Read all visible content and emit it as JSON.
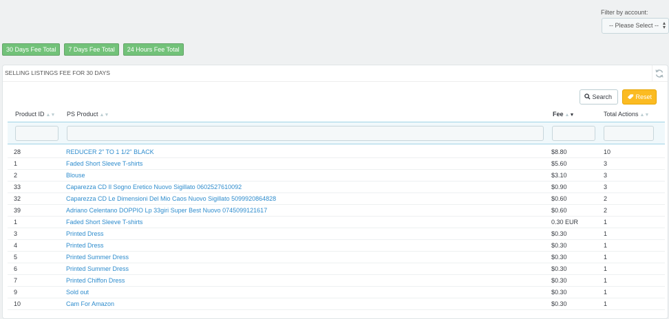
{
  "filter": {
    "label": "Filter by account:",
    "selected": "-- Please Select --"
  },
  "fee_buttons": [
    "30 Days Fee Total",
    "7 Days Fee Total",
    "24 Hours Fee Total"
  ],
  "panel": {
    "title": "SELLING LISTINGS FEE FOR 30 DAYS"
  },
  "actions": {
    "search": "Search",
    "reset": "Reset"
  },
  "columns": {
    "id": "Product ID",
    "product": "PS Product",
    "fee": "Fee",
    "actions": "Total Actions"
  },
  "colors": {
    "accent_green": "#72c279",
    "link_blue": "#2e8ccd",
    "reset_orange": "#fbbb22"
  },
  "rows": [
    {
      "id": "28",
      "product": "REDUCER 2\" TO 1 1/2\" BLACK",
      "fee": "$8.80",
      "actions": "10"
    },
    {
      "id": "1",
      "product": "Faded Short Sleeve T-shirts",
      "fee": "$5.60",
      "actions": "3"
    },
    {
      "id": "2",
      "product": "Blouse",
      "fee": "$3.10",
      "actions": "3"
    },
    {
      "id": "33",
      "product": "Caparezza CD Il Sogno Eretico Nuovo Sigillato 0602527610092",
      "fee": "$0.90",
      "actions": "3"
    },
    {
      "id": "32",
      "product": "Caparezza CD Le Dimensioni Del Mio Caos Nuovo Sigillato 5099920864828",
      "fee": "$0.60",
      "actions": "2"
    },
    {
      "id": "39",
      "product": "Adriano Celentano DOPPIO Lp 33giri Super Best Nuovo 0745099121617",
      "fee": "$0.60",
      "actions": "2"
    },
    {
      "id": "1",
      "product": "Faded Short Sleeve T-shirts",
      "fee": "0.30 EUR",
      "actions": "1"
    },
    {
      "id": "3",
      "product": "Printed Dress",
      "fee": "$0.30",
      "actions": "1"
    },
    {
      "id": "4",
      "product": "Printed Dress",
      "fee": "$0.30",
      "actions": "1"
    },
    {
      "id": "5",
      "product": "Printed Summer Dress",
      "fee": "$0.30",
      "actions": "1"
    },
    {
      "id": "6",
      "product": "Printed Summer Dress",
      "fee": "$0.30",
      "actions": "1"
    },
    {
      "id": "7",
      "product": "Printed Chiffon Dress",
      "fee": "$0.30",
      "actions": "1"
    },
    {
      "id": "9",
      "product": "Sold out",
      "fee": "$0.30",
      "actions": "1"
    },
    {
      "id": "10",
      "product": "Cam For Amazon",
      "fee": "$0.30",
      "actions": "1"
    }
  ]
}
